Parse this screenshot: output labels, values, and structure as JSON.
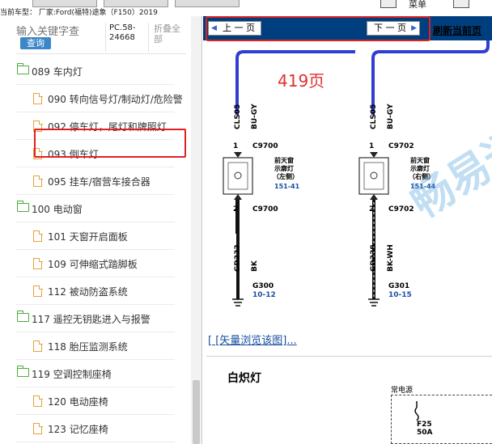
{
  "topbar": {
    "car_info": "当前车型：  厂家:Ford(福特)途象（F150）2019",
    "menu_label": "菜单"
  },
  "sidebar": {
    "search_placeholder": "输入关键字查",
    "query_button": "查询",
    "pc_code": "PC.58-24668",
    "collapse_all": "折叠全部",
    "items": [
      {
        "type": "folder",
        "label": "089 车内灯"
      },
      {
        "type": "file",
        "label": "090 转向信号灯/制动灯/危险警"
      },
      {
        "type": "file",
        "label": "092 停车灯，尾灯和牌照灯"
      },
      {
        "type": "file",
        "label": "093 倒车灯"
      },
      {
        "type": "file",
        "label": "095 挂车/宿营车接合器"
      },
      {
        "type": "folder",
        "label": "100 电动窗"
      },
      {
        "type": "file",
        "label": "101 天窗开启面板"
      },
      {
        "type": "file",
        "label": "109 可伸缩式踏脚板"
      },
      {
        "type": "file",
        "label": "112 被动防盗系统"
      },
      {
        "type": "folder",
        "label": "117 遥控无钥匙进入与报警"
      },
      {
        "type": "file",
        "label": "118 胎压监测系统"
      },
      {
        "type": "folder",
        "label": "119 空调控制座椅"
      },
      {
        "type": "file",
        "label": "120 电动座椅"
      },
      {
        "type": "file",
        "label": "123 记忆座椅"
      }
    ]
  },
  "main": {
    "prev_button": "上 一 页",
    "next_button": "下 一 页",
    "refresh_link": "刷新当前页",
    "page_label": "419页",
    "watermark": "畅易通",
    "vector_link": "[ [矢量浏览该图]...",
    "section_title": "白炽灯",
    "power_title": "常电源",
    "fuse_label": "F25\n50A"
  },
  "diagram": {
    "left": {
      "wire_top_code": "CLS05",
      "wire_top_color": "BU-GY",
      "pin_top": "1",
      "conn_top": "C9700",
      "lamp_name_1": "前天窗",
      "lamp_name_2": "示廓灯",
      "lamp_name_3": "（左侧）",
      "lamp_ref": "151-41",
      "pin_bottom": "2",
      "conn_bottom": "C9700",
      "wire_bottom_code": "GD233",
      "wire_bottom_color": "BK",
      "ground": "G300",
      "ground_ref": "10-12"
    },
    "right": {
      "wire_top_code": "CLS05",
      "wire_top_color": "BU-GY",
      "pin_top": "1",
      "conn_top": "C9702",
      "lamp_name_1": "前天窗",
      "lamp_name_2": "示廓灯",
      "lamp_name_3": "（右侧）",
      "lamp_ref": "151-44",
      "pin_bottom": "2",
      "conn_bottom": "C9702",
      "wire_bottom_code": "GD238",
      "wire_bottom_color": "BK-WH",
      "ground": "G301",
      "ground_ref": "10-15"
    }
  },
  "colors": {
    "navbar": "#003f7f",
    "highlight": "#e02020",
    "folder_icon": "#4cae3c",
    "file_icon": "#e6a23c",
    "query_button": "#3d87c9",
    "wire_blue": "#2f3fd0"
  }
}
